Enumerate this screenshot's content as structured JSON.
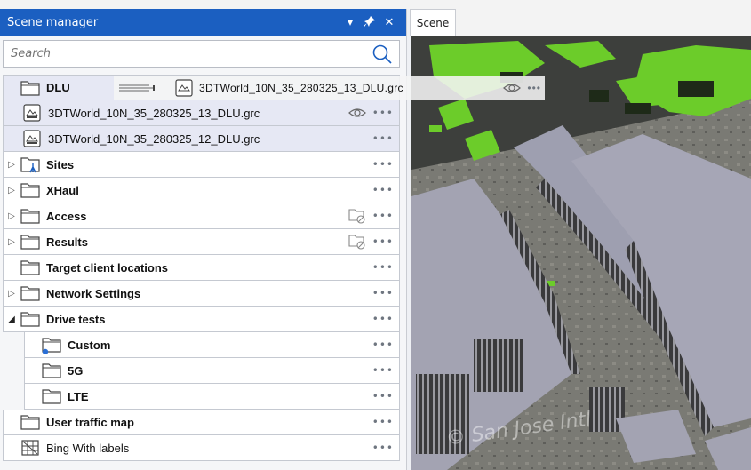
{
  "panel": {
    "title": "Scene manager",
    "search_placeholder": "Search"
  },
  "tree": {
    "dlu": "DLU",
    "dlu_files": [
      "3DTWorld_10N_35_280325_13_DLU.grc",
      "3DTWorld_10N_35_280325_12_DLU.grc"
    ],
    "sites": "Sites",
    "xhaul": "XHaul",
    "access": "Access",
    "results": "Results",
    "target": "Target client locations",
    "network": "Network Settings",
    "drive": "Drive tests",
    "custom": "Custom",
    "g5": "5G",
    "lte": "LTE",
    "traffic": "User traffic map",
    "bing": "Bing With labels"
  },
  "drag_ghost": {
    "label": "3DTWorld_10N_35_280325_13_DLU.grc"
  },
  "scene": {
    "tab": "Scene",
    "watermark": "© San Jose Intl"
  },
  "colors": {
    "header": "#1b5fc1",
    "selected_row": "#e6e8f4",
    "vegetation": "#6ccc2a",
    "rooftop": "#9e9fb0"
  }
}
